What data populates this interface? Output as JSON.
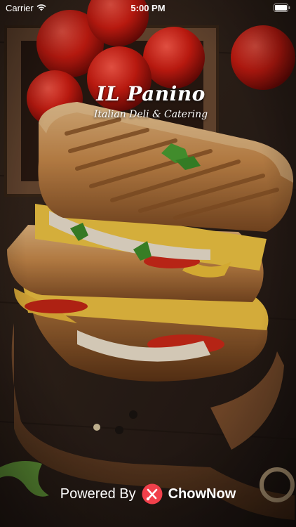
{
  "status_bar": {
    "carrier": "Carrier",
    "time": "5:00 PM",
    "wifi_icon": "wifi-icon",
    "battery_icon": "battery-icon"
  },
  "brand": {
    "title": "IL Panino",
    "subtitle": "Italian Deli & Catering"
  },
  "footer": {
    "powered_by": "Powered By",
    "provider": "ChowNow",
    "logo_icon": "chownow-logo-icon"
  },
  "colors": {
    "background": "#2b1f17",
    "text": "#ffffff",
    "chownow_red": "#f1404b"
  }
}
